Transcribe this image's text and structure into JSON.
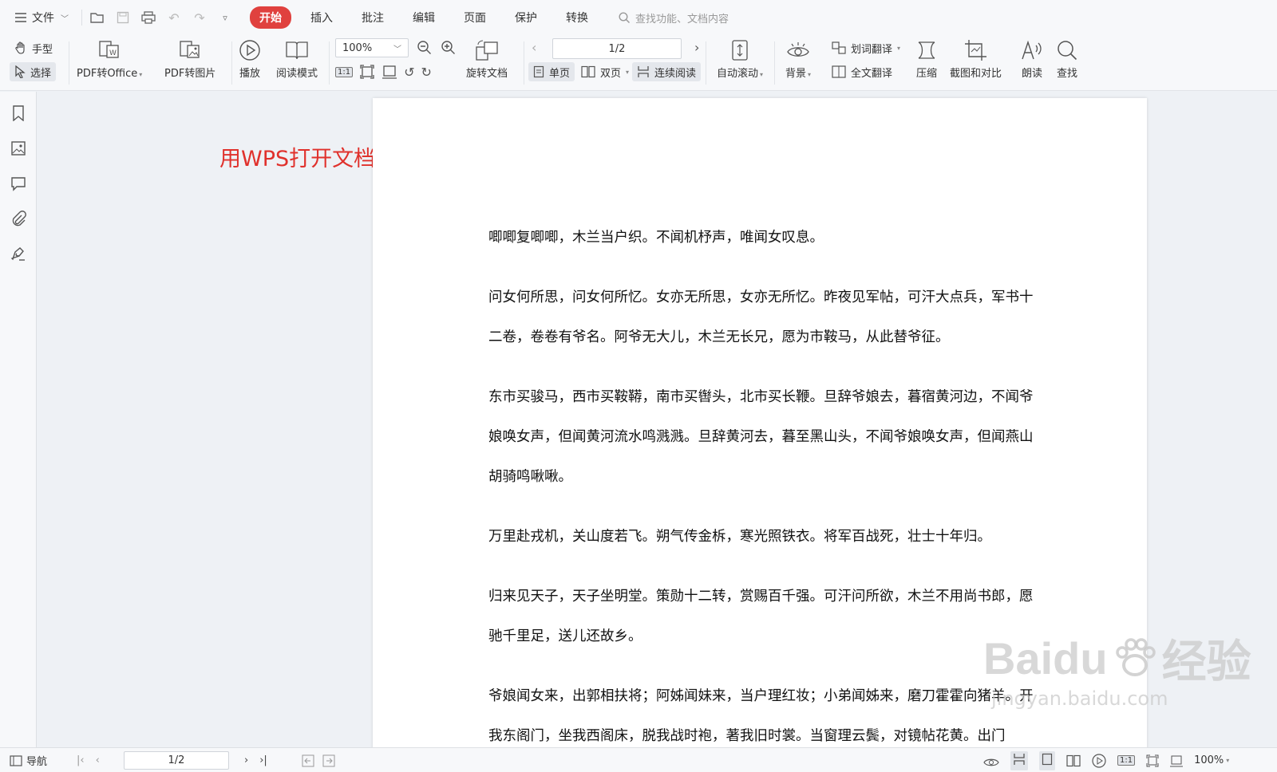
{
  "menubar": {
    "file_label": "文件",
    "tabs": [
      {
        "label": "开始",
        "active": true
      },
      {
        "label": "插入",
        "active": false
      },
      {
        "label": "批注",
        "active": false
      },
      {
        "label": "编辑",
        "active": false
      },
      {
        "label": "页面",
        "active": false
      },
      {
        "label": "保护",
        "active": false
      },
      {
        "label": "转换",
        "active": false
      }
    ],
    "search_placeholder": "查找功能、文档内容"
  },
  "toolbar": {
    "hand_tool": "手型",
    "select_tool": "选择",
    "pdf_to_office": "PDF转Office",
    "pdf_to_image": "PDF转图片",
    "play": "播放",
    "read_mode": "阅读模式",
    "zoom_value": "100%",
    "rotate_doc": "旋转文档",
    "page_indicator": "1/2",
    "single_page": "单页",
    "double_page": "双页",
    "continuous_read": "连续阅读",
    "auto_scroll": "自动滚动",
    "background": "背景",
    "word_translate": "划词翻译",
    "full_translate": "全文翻译",
    "compress": "压缩",
    "screenshot_compare": "截图和对比",
    "read_aloud": "朗读",
    "find": "查找",
    "accent_color": "#e0413e"
  },
  "annotation_text": "用WPS打开文档",
  "document": {
    "paragraphs": [
      "唧唧复唧唧，木兰当户织。不闻机杼声，唯闻女叹息。",
      "问女何所思，问女何所忆。女亦无所思，女亦无所忆。昨夜见军帖，可汗大点兵，军书十二卷，卷卷有爷名。阿爷无大儿，木兰无长兄，愿为市鞍马，从此替爷征。",
      "东市买骏马，西市买鞍鞯，南市买辔头，北市买长鞭。旦辞爷娘去，暮宿黄河边，不闻爷娘唤女声，但闻黄河流水鸣溅溅。旦辞黄河去，暮至黑山头，不闻爷娘唤女声，但闻燕山胡骑鸣啾啾。",
      "万里赴戎机，关山度若飞。朔气传金柝，寒光照铁衣。将军百战死，壮士十年归。",
      "归来见天子，天子坐明堂。策勋十二转，赏赐百千强。可汗问所欲，木兰不用尚书郎，愿驰千里足，送儿还故乡。",
      "爷娘闻女来，出郭相扶将；阿姊闻妹来，当户理红妆；小弟闻姊来，磨刀霍霍向猪羊。开我东阁门，坐我西阁床，脱我战时袍，著我旧时裳。当窗理云鬓，对镜帖花黄。出门"
    ]
  },
  "watermark": {
    "brand": "Baidu",
    "brand_cn": "经验",
    "url": "jingyan.baidu.com"
  },
  "statusbar": {
    "nav_label": "导航",
    "page_indicator": "1/2",
    "zoom_value": "100%"
  }
}
